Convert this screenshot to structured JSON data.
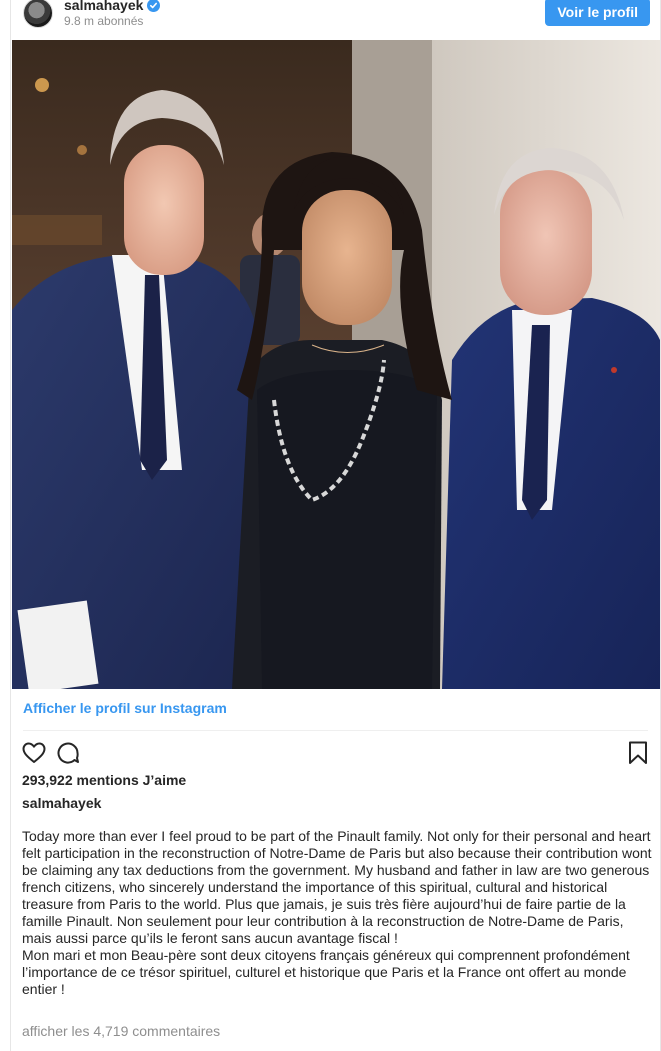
{
  "header": {
    "username": "salmahayek",
    "followers": "9.8 m abonnés",
    "view_profile_button": "Voir le profil"
  },
  "post": {
    "view_on_instagram": "Afficher le profil sur Instagram",
    "likes": "293,922 mentions J’aime",
    "author": "salmahayek",
    "caption": "Today more than ever I feel proud to be part of the Pinault family. Not only for their personal and heart felt participation in the reconstruction of Notre-Dame de Paris but also because their contribution wont be claiming any tax deductions from the government. My husband and father in law are two generous french citizens, who sincerely understand the importance of this spiritual, cultural and historical treasure from Paris to the world. Plus que jamais, je suis très fière aujourd’hui de faire partie de la famille Pinault. Non seulement pour leur contribution à la reconstruction de Notre-Dame de Paris, mais aussi parce qu’ils le feront sans aucun avantage fiscal !\nMon mari et mon Beau-père sont deux citoyens français généreux qui comprennent profondément l’importance de ce trésor spirituel, culturel et historique que Paris et la France ont offert au monde entier !",
    "view_comments": "afficher les 4,719 commentaires"
  },
  "icons": {
    "verified": "verified-badge-icon",
    "like": "heart-icon",
    "comment": "comment-bubble-icon",
    "save": "bookmark-icon"
  },
  "colors": {
    "accent": "#3897f0",
    "text": "#262626",
    "muted": "#8e8e8e"
  }
}
